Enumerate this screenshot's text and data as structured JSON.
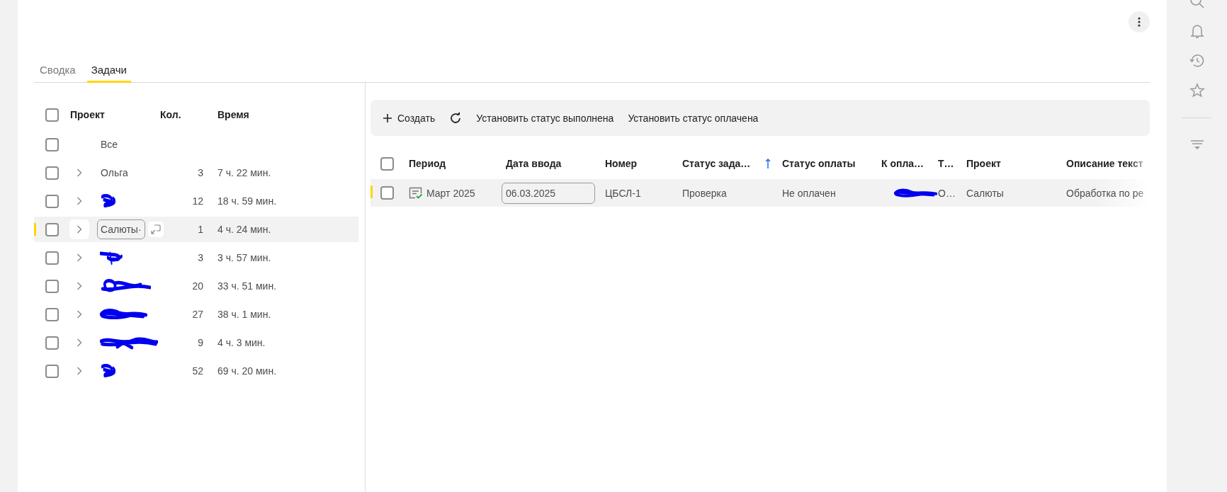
{
  "tabs": [
    {
      "label": "Сводка",
      "selected": false
    },
    {
      "label": "Задачи",
      "selected": true
    }
  ],
  "projects": {
    "header_checked": false,
    "columns": [
      "Проект",
      "Кол.",
      "Время"
    ],
    "rows": [
      {
        "kind": "all",
        "name": "Все",
        "checked": false,
        "selected": false
      },
      {
        "kind": "name",
        "name": "Ольга",
        "count": "3",
        "time": "7 ч. 22 мин.",
        "checked": false,
        "selected": false
      },
      {
        "kind": "redacted",
        "count": "12",
        "time": "18 ч. 59 мин.",
        "checked": false,
        "selected": false
      },
      {
        "kind": "editing",
        "name": "Салюты·",
        "count": "1",
        "time": "4 ч. 24 мин.",
        "checked": false,
        "selected": true
      },
      {
        "kind": "redacted",
        "count": "3",
        "time": "3 ч. 57 мин.",
        "checked": false,
        "selected": false
      },
      {
        "kind": "redacted",
        "count": "20",
        "time": "33 ч. 51 мин.",
        "checked": false,
        "selected": false
      },
      {
        "kind": "redacted",
        "count": "27",
        "time": "38 ч. 1 мин.",
        "checked": false,
        "selected": false
      },
      {
        "kind": "redacted",
        "count": "9",
        "time": "4 ч. 3 мин.",
        "checked": false,
        "selected": false
      },
      {
        "kind": "redacted",
        "count": "52",
        "time": "69 ч. 20 мин.",
        "checked": false,
        "selected": false
      }
    ]
  },
  "toolbar": {
    "actions": [
      {
        "kind": "create",
        "label": "Создать"
      },
      {
        "kind": "refresh"
      },
      {
        "kind": "text",
        "label": "Установить статус выполнена"
      },
      {
        "kind": "text",
        "label": "Установить статус оплачена"
      }
    ]
  },
  "tasks": {
    "header_checked": false,
    "columns": [
      {
        "label": "Период"
      },
      {
        "label": "Дата ввода"
      },
      {
        "label": "Номер"
      },
      {
        "label": "Статус зада…",
        "sort_ascending": true
      },
      {
        "label": "Статус оплаты"
      },
      {
        "label": "К опла…"
      },
      {
        "label": "Т…"
      },
      {
        "label": "Проект"
      },
      {
        "label": "Описание текст"
      }
    ],
    "rows": [
      {
        "checked": false,
        "selected": true,
        "period": "Март 2025",
        "date": "06.03.2025",
        "number": "ЦБСЛ-1",
        "task_status": "Проверка",
        "payment_status": "Не оплачен",
        "to_pay_redacted": true,
        "column_7": "О…",
        "project": "Салюты",
        "description": "Обработка по ре"
      }
    ]
  }
}
